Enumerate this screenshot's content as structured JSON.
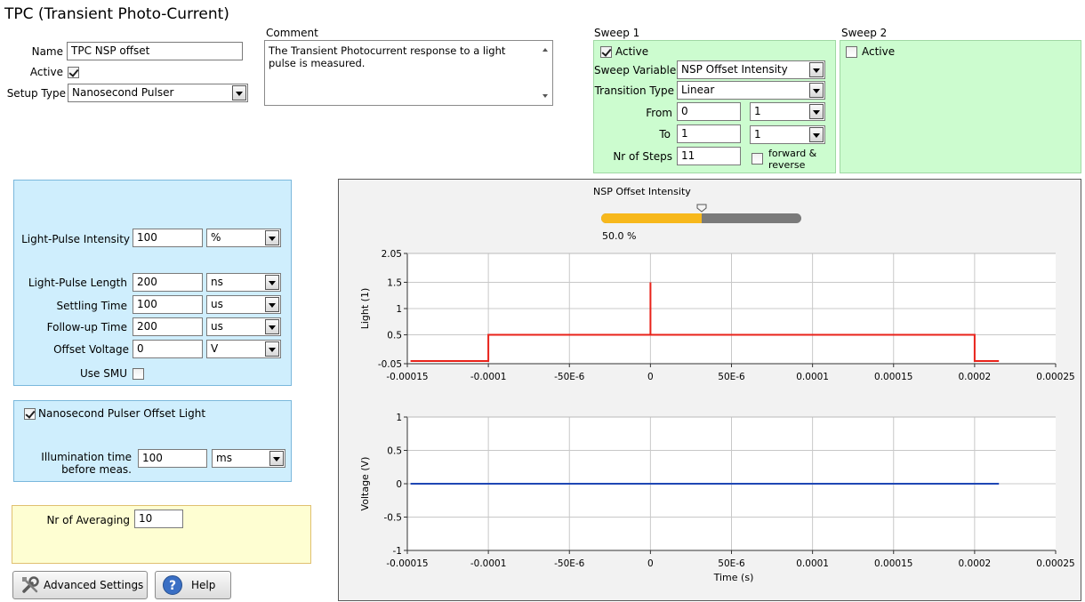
{
  "title": "TPC (Transient Photo-Current)",
  "general": {
    "name_label": "Name",
    "name_value": "TPC NSP offset",
    "active_label": "Active",
    "active_checked": true,
    "setup_label": "Setup Type",
    "setup_value": "Nanosecond Pulser"
  },
  "comment": {
    "label": "Comment",
    "text": "The Transient Photocurrent response to a light pulse is measured."
  },
  "sweep1": {
    "title": "Sweep 1",
    "active_label": "Active",
    "active_checked": true,
    "variable_label": "Sweep Variable",
    "variable_value": "NSP Offset Intensity",
    "transition_label": "Transition Type",
    "transition_value": "Linear",
    "from_label": "From",
    "from_value": "0",
    "from_unit": "1",
    "to_label": "To",
    "to_value": "1",
    "to_unit": "1",
    "steps_label": "Nr of Steps",
    "steps_value": "11",
    "fr_label_1": "forward &",
    "fr_label_2": "reverse",
    "fr_checked": false
  },
  "sweep2": {
    "title": "Sweep 2",
    "active_label": "Active",
    "active_checked": false
  },
  "pulse": {
    "intensity_label": "Light-Pulse Intensity",
    "intensity_value": "100",
    "intensity_unit": "%",
    "length_label": "Light-Pulse Length",
    "length_value": "200",
    "length_unit": "ns",
    "settling_label": "Settling Time",
    "settling_value": "100",
    "settling_unit": "us",
    "followup_label": "Follow-up Time",
    "followup_value": "200",
    "followup_unit": "us",
    "offset_label": "Offset Voltage",
    "offset_value": "0",
    "offset_unit": "V",
    "smu_label": "Use SMU",
    "smu_checked": false
  },
  "offset_light": {
    "label": "Nanosecond Pulser Offset Light",
    "checked": true,
    "illum_label_1": "Illumination time",
    "illum_label_2": "before meas.",
    "illum_value": "100",
    "illum_unit": "ms"
  },
  "averaging": {
    "label": "Nr of Averaging",
    "value": "10"
  },
  "buttons": {
    "advanced": "Advanced Settings",
    "help": "Help"
  },
  "preview": {
    "slider_label": "NSP Offset Intensity",
    "slider_value": 50.0,
    "slider_text": "50.0 %",
    "colors": {
      "fill": "#f7b81c",
      "track": "#7a7a7a",
      "light": "#e8221a",
      "voltage": "#1f47b4"
    }
  },
  "chart_data": [
    {
      "type": "line",
      "ylabel": "Light (1)",
      "xlim": [
        -0.00015,
        0.00025
      ],
      "ylim": [
        -0.05,
        2.05
      ],
      "yticks": [
        "2.05",
        "1.5",
        "1",
        "0.5",
        "-0.05"
      ],
      "ytick_values": [
        2.05,
        1.5,
        1,
        0.5,
        -0.05
      ],
      "xticks": [
        "-0.00015",
        "-0.0001",
        "-50E-6",
        "0",
        "50E-6",
        "0.0001",
        "0.00015",
        "0.0002",
        "0.00025"
      ],
      "xtick_values": [
        -0.00015,
        -0.0001,
        -5e-05,
        0,
        5e-05,
        0.0001,
        0.00015,
        0.0002,
        0.00025
      ],
      "grid": true,
      "series": [
        {
          "x": [
            -0.000148,
            -0.0001,
            -0.0001,
            0,
            0,
            0,
            0.0002,
            0.0002,
            0.000215
          ],
          "y": [
            0,
            0,
            0.5,
            0.5,
            1.5,
            0.5,
            0.5,
            0,
            0
          ]
        }
      ]
    },
    {
      "type": "line",
      "ylabel": "Voltage (V)",
      "xlabel": "Time (s)",
      "xlim": [
        -0.00015,
        0.00025
      ],
      "ylim": [
        -1,
        1
      ],
      "yticks": [
        "1",
        "0.5",
        "0",
        "-0.5",
        "-1"
      ],
      "ytick_values": [
        1,
        0.5,
        0,
        -0.5,
        -1
      ],
      "xticks": [
        "-0.00015",
        "-0.0001",
        "-50E-6",
        "0",
        "50E-6",
        "0.0001",
        "0.00015",
        "0.0002",
        "0.00025"
      ],
      "xtick_values": [
        -0.00015,
        -0.0001,
        -5e-05,
        0,
        5e-05,
        0.0001,
        0.00015,
        0.0002,
        0.00025
      ],
      "grid": true,
      "series": [
        {
          "x": [
            -0.000148,
            0.000215
          ],
          "y": [
            0,
            0
          ]
        }
      ]
    }
  ]
}
